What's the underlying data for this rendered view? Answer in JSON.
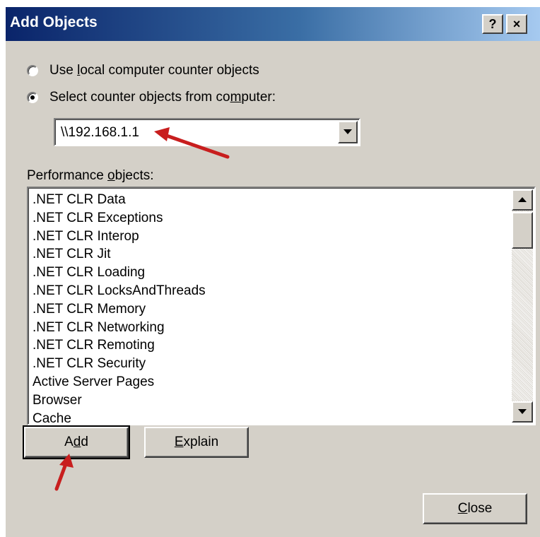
{
  "window": {
    "title": "Add Objects",
    "help_label": "?",
    "close_label": "×"
  },
  "source": {
    "local_option_label": "Use local computer counter objects",
    "remote_option_label": "Select counter objects from computer:",
    "selected_option": "remote",
    "computer_value": "\\\\192.168.1.1"
  },
  "objects": {
    "label": "Performance objects:",
    "items": [
      ".NET CLR Data",
      ".NET CLR Exceptions",
      ".NET CLR Interop",
      ".NET CLR Jit",
      ".NET CLR Loading",
      ".NET CLR LocksAndThreads",
      ".NET CLR Memory",
      ".NET CLR Networking",
      ".NET CLR Remoting",
      ".NET CLR Security",
      "Active Server Pages",
      "Browser",
      "Cache"
    ]
  },
  "buttons": {
    "add": "Add",
    "explain": "Explain",
    "close": "Close"
  },
  "colors": {
    "title_start": "#0a246a",
    "title_end": "#a6caf0",
    "dialog_bg": "#d4d0c8",
    "annotation_arrow": "#c81e1e"
  },
  "icons": {
    "dropdown": "triangle-down",
    "scroll_up": "triangle-up",
    "scroll_down": "triangle-down"
  }
}
